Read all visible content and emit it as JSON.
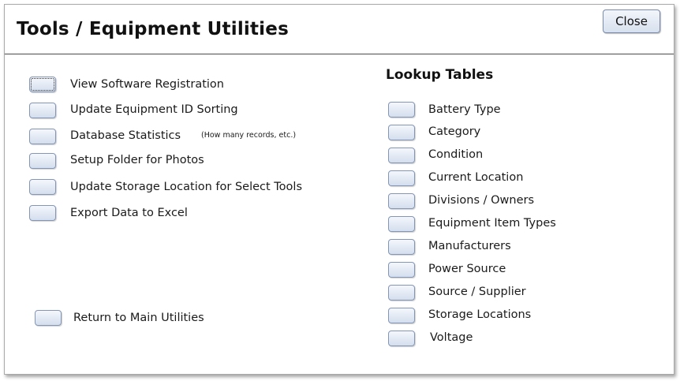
{
  "window": {
    "title": "Tools / Equipment Utilities",
    "close_label": "Close"
  },
  "left_actions": [
    {
      "label": "View Software Registration"
    },
    {
      "label": "Update Equipment ID Sorting"
    },
    {
      "label": "Database Statistics",
      "note": "(How many records, etc.)"
    },
    {
      "label": "Setup Folder for Photos"
    },
    {
      "label": "Update Storage Location for Select Tools"
    },
    {
      "label": "Export Data to Excel"
    }
  ],
  "return_label": "Return to Main Utilities",
  "lookup": {
    "title": "Lookup Tables",
    "items": [
      "Battery Type",
      "Category",
      "Condition",
      "Current Location",
      "Divisions / Owners",
      "Equipment Item Types",
      "Manufacturers",
      "Power Source",
      "Source / Supplier",
      "Storage Locations",
      "Voltage"
    ]
  }
}
